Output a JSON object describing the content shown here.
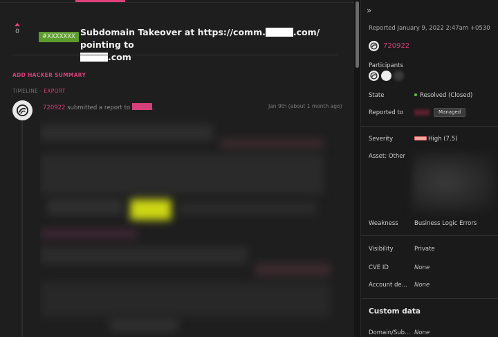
{
  "report": {
    "vote_count": "0",
    "id_badge": "#XXXXXXX",
    "title_part1": "Subdomain Takeover at https://comm.",
    "title_part2": ".com/ pointing to",
    "title_part3": ".com",
    "add_hacker_summary": "ADD HACKER SUMMARY",
    "timeline_label": "TIMELINE",
    "timeline_sep": "·",
    "export_label": "EXPORT"
  },
  "activity": {
    "user": "720922",
    "text": " submitted a report to ",
    "suffix": ".",
    "time": "Jan 9th (about 1 month ago)"
  },
  "sidebar": {
    "collapse_icon": "»",
    "reported_date": "Reported January 9, 2022 2:47am +0530",
    "reporter": "720922",
    "participants_label": "Participants",
    "state_label": "State",
    "state_value": "Resolved (Closed)",
    "reported_to_label": "Reported to",
    "managed_badge": "Managed",
    "severity_label": "Severity",
    "severity_value": "High (7.5)",
    "asset_label": "Asset: Other",
    "weakness_label": "Weakness",
    "weakness_value": "Business Logic Errors",
    "visibility_label": "Visibility",
    "visibility_value": "Private",
    "cve_label": "CVE ID",
    "cve_value": "None",
    "account_label": "Account de...",
    "account_value": "None",
    "custom_data_title": "Custom data",
    "domain_label": "Domain/Sub...",
    "domain_value": "None"
  },
  "colors": {
    "accent_pink": "#d6407a",
    "badge_green": "#5c9d2c",
    "state_green": "#6abf3a",
    "severity_high": "#f0a8a0"
  }
}
